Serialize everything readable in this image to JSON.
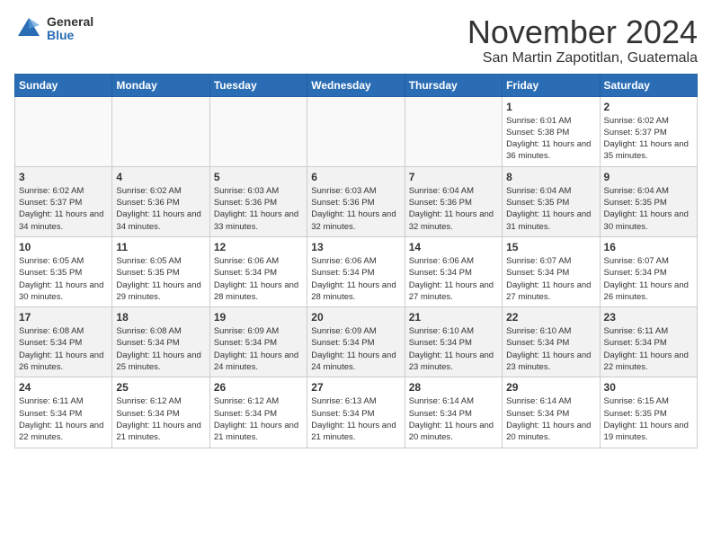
{
  "header": {
    "logo_general": "General",
    "logo_blue": "Blue",
    "month_title": "November 2024",
    "location": "San Martin Zapotitlan, Guatemala"
  },
  "calendar": {
    "days_of_week": [
      "Sunday",
      "Monday",
      "Tuesday",
      "Wednesday",
      "Thursday",
      "Friday",
      "Saturday"
    ],
    "weeks": [
      [
        {
          "day": "",
          "info": ""
        },
        {
          "day": "",
          "info": ""
        },
        {
          "day": "",
          "info": ""
        },
        {
          "day": "",
          "info": ""
        },
        {
          "day": "",
          "info": ""
        },
        {
          "day": "1",
          "info": "Sunrise: 6:01 AM\nSunset: 5:38 PM\nDaylight: 11 hours and 36 minutes."
        },
        {
          "day": "2",
          "info": "Sunrise: 6:02 AM\nSunset: 5:37 PM\nDaylight: 11 hours and 35 minutes."
        }
      ],
      [
        {
          "day": "3",
          "info": "Sunrise: 6:02 AM\nSunset: 5:37 PM\nDaylight: 11 hours and 34 minutes."
        },
        {
          "day": "4",
          "info": "Sunrise: 6:02 AM\nSunset: 5:36 PM\nDaylight: 11 hours and 34 minutes."
        },
        {
          "day": "5",
          "info": "Sunrise: 6:03 AM\nSunset: 5:36 PM\nDaylight: 11 hours and 33 minutes."
        },
        {
          "day": "6",
          "info": "Sunrise: 6:03 AM\nSunset: 5:36 PM\nDaylight: 11 hours and 32 minutes."
        },
        {
          "day": "7",
          "info": "Sunrise: 6:04 AM\nSunset: 5:36 PM\nDaylight: 11 hours and 32 minutes."
        },
        {
          "day": "8",
          "info": "Sunrise: 6:04 AM\nSunset: 5:35 PM\nDaylight: 11 hours and 31 minutes."
        },
        {
          "day": "9",
          "info": "Sunrise: 6:04 AM\nSunset: 5:35 PM\nDaylight: 11 hours and 30 minutes."
        }
      ],
      [
        {
          "day": "10",
          "info": "Sunrise: 6:05 AM\nSunset: 5:35 PM\nDaylight: 11 hours and 30 minutes."
        },
        {
          "day": "11",
          "info": "Sunrise: 6:05 AM\nSunset: 5:35 PM\nDaylight: 11 hours and 29 minutes."
        },
        {
          "day": "12",
          "info": "Sunrise: 6:06 AM\nSunset: 5:34 PM\nDaylight: 11 hours and 28 minutes."
        },
        {
          "day": "13",
          "info": "Sunrise: 6:06 AM\nSunset: 5:34 PM\nDaylight: 11 hours and 28 minutes."
        },
        {
          "day": "14",
          "info": "Sunrise: 6:06 AM\nSunset: 5:34 PM\nDaylight: 11 hours and 27 minutes."
        },
        {
          "day": "15",
          "info": "Sunrise: 6:07 AM\nSunset: 5:34 PM\nDaylight: 11 hours and 27 minutes."
        },
        {
          "day": "16",
          "info": "Sunrise: 6:07 AM\nSunset: 5:34 PM\nDaylight: 11 hours and 26 minutes."
        }
      ],
      [
        {
          "day": "17",
          "info": "Sunrise: 6:08 AM\nSunset: 5:34 PM\nDaylight: 11 hours and 26 minutes."
        },
        {
          "day": "18",
          "info": "Sunrise: 6:08 AM\nSunset: 5:34 PM\nDaylight: 11 hours and 25 minutes."
        },
        {
          "day": "19",
          "info": "Sunrise: 6:09 AM\nSunset: 5:34 PM\nDaylight: 11 hours and 24 minutes."
        },
        {
          "day": "20",
          "info": "Sunrise: 6:09 AM\nSunset: 5:34 PM\nDaylight: 11 hours and 24 minutes."
        },
        {
          "day": "21",
          "info": "Sunrise: 6:10 AM\nSunset: 5:34 PM\nDaylight: 11 hours and 23 minutes."
        },
        {
          "day": "22",
          "info": "Sunrise: 6:10 AM\nSunset: 5:34 PM\nDaylight: 11 hours and 23 minutes."
        },
        {
          "day": "23",
          "info": "Sunrise: 6:11 AM\nSunset: 5:34 PM\nDaylight: 11 hours and 22 minutes."
        }
      ],
      [
        {
          "day": "24",
          "info": "Sunrise: 6:11 AM\nSunset: 5:34 PM\nDaylight: 11 hours and 22 minutes."
        },
        {
          "day": "25",
          "info": "Sunrise: 6:12 AM\nSunset: 5:34 PM\nDaylight: 11 hours and 21 minutes."
        },
        {
          "day": "26",
          "info": "Sunrise: 6:12 AM\nSunset: 5:34 PM\nDaylight: 11 hours and 21 minutes."
        },
        {
          "day": "27",
          "info": "Sunrise: 6:13 AM\nSunset: 5:34 PM\nDaylight: 11 hours and 21 minutes."
        },
        {
          "day": "28",
          "info": "Sunrise: 6:14 AM\nSunset: 5:34 PM\nDaylight: 11 hours and 20 minutes."
        },
        {
          "day": "29",
          "info": "Sunrise: 6:14 AM\nSunset: 5:34 PM\nDaylight: 11 hours and 20 minutes."
        },
        {
          "day": "30",
          "info": "Sunrise: 6:15 AM\nSunset: 5:35 PM\nDaylight: 11 hours and 19 minutes."
        }
      ]
    ]
  }
}
